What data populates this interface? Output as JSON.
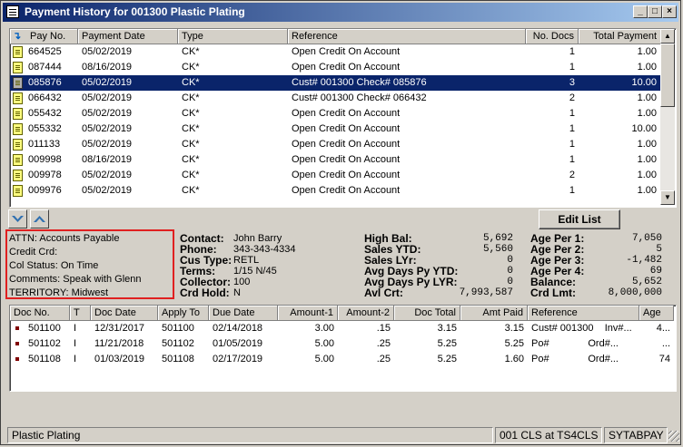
{
  "window": {
    "title": "Payment History for 001300 Plastic Plating"
  },
  "payments": {
    "columns": [
      "Pay No.",
      "Payment Date",
      "Type",
      "Reference",
      "No. Docs",
      "Total Payment"
    ],
    "rows": [
      {
        "pay_no": "664525",
        "date": "05/02/2019",
        "type": "CK*",
        "reference": "Open Credit On Account",
        "docs": "1",
        "total": "1.00"
      },
      {
        "pay_no": "087444",
        "date": "08/16/2019",
        "type": "CK*",
        "reference": "Open Credit On Account",
        "docs": "1",
        "total": "1.00"
      },
      {
        "pay_no": "085876",
        "date": "05/02/2019",
        "type": "CK*",
        "reference": "Cust# 001300  Check# 085876",
        "docs": "3",
        "total": "10.00"
      },
      {
        "pay_no": "066432",
        "date": "05/02/2019",
        "type": "CK*",
        "reference": "Cust# 001300  Check# 066432",
        "docs": "2",
        "total": "1.00"
      },
      {
        "pay_no": "055432",
        "date": "05/02/2019",
        "type": "CK*",
        "reference": "Open Credit On Account",
        "docs": "1",
        "total": "1.00"
      },
      {
        "pay_no": "055332",
        "date": "05/02/2019",
        "type": "CK*",
        "reference": "Open Credit On Account",
        "docs": "1",
        "total": "10.00"
      },
      {
        "pay_no": "011133",
        "date": "05/02/2019",
        "type": "CK*",
        "reference": "Open Credit On Account",
        "docs": "1",
        "total": "1.00"
      },
      {
        "pay_no": "009998",
        "date": "08/16/2019",
        "type": "CK*",
        "reference": "Open Credit On Account",
        "docs": "1",
        "total": "1.00"
      },
      {
        "pay_no": "009978",
        "date": "05/02/2019",
        "type": "CK*",
        "reference": "Open Credit On Account",
        "docs": "2",
        "total": "1.00"
      },
      {
        "pay_no": "009976",
        "date": "05/02/2019",
        "type": "CK*",
        "reference": "Open Credit On Account",
        "docs": "1",
        "total": "1.00"
      }
    ]
  },
  "toolbar": {
    "edit_list": "Edit List"
  },
  "notes": {
    "attn": "ATTN: Accounts Payable",
    "credit": "Credit Crd:",
    "col_status": "Col Status: On Time",
    "comments": "Comments: Speak with Glenn",
    "territory": "TERRITORY: Midwest"
  },
  "customer": {
    "contact_label": "Contact:",
    "contact": "John Barry",
    "phone_label": "Phone:",
    "phone": "343-343-4334",
    "custype_label": "Cus Type:",
    "custype": "RETL",
    "terms_label": "Terms:",
    "terms": "1/15 N/45",
    "collector_label": "Collector:",
    "collector": "100",
    "crdhold_label": "Crd Hold:",
    "crdhold": "N"
  },
  "stats": {
    "high_bal_label": "High Bal:",
    "high_bal": "5,692",
    "sales_ytd_label": "Sales YTD:",
    "sales_ytd": "5,560",
    "sales_lyr_label": "Sales LYr:",
    "sales_lyr": "0",
    "avg_ytd_label": "Avg Days Py YTD:",
    "avg_ytd": "0",
    "avg_lyr_label": "Avg Days Py LYR:",
    "avg_lyr": "0",
    "avl_crt_label": "Avl Crt:",
    "avl_crt": "7,993,587"
  },
  "aging": {
    "age1_label": "Age Per 1:",
    "age1": "7,050",
    "age2_label": "Age Per 2:",
    "age2": "5",
    "age3_label": "Age Per 3:",
    "age3": "-1,482",
    "age4_label": "Age Per 4:",
    "age4": "69",
    "balance_label": "Balance:",
    "balance": "5,652",
    "crd_lmt_label": "Crd Lmt:",
    "crd_lmt": "8,000,000"
  },
  "docs": {
    "columns": [
      "Doc No.",
      "T",
      "Doc Date",
      "Apply To",
      "Due Date",
      "Amount-1",
      "Amount-2",
      "Doc Total",
      "Amt Paid",
      "Reference",
      "Age"
    ],
    "rows": [
      {
        "doc_no": "501100",
        "t": "I",
        "doc_date": "12/31/2017",
        "apply_to": "501100",
        "due_date": "02/14/2018",
        "amt1": "3.00",
        "amt2": ".15",
        "doc_total": "3.15",
        "amt_paid": "3.15",
        "reference": "Cust# 001300    Inv#...",
        "age": "4..."
      },
      {
        "doc_no": "501102",
        "t": "I",
        "doc_date": "11/21/2018",
        "apply_to": "501102",
        "due_date": "01/05/2019",
        "amt1": "5.00",
        "amt2": ".25",
        "doc_total": "5.25",
        "amt_paid": "5.25",
        "reference": "Po#              Ord#...",
        "age": "..."
      },
      {
        "doc_no": "501108",
        "t": "I",
        "doc_date": "01/03/2019",
        "apply_to": "501108",
        "due_date": "02/17/2019",
        "amt1": "5.00",
        "amt2": ".25",
        "doc_total": "5.25",
        "amt_paid": "1.60",
        "reference": "Po#              Ord#...",
        "age": "74"
      }
    ]
  },
  "statusbar": {
    "customer": "Plastic Plating",
    "location": "001 CLS at TS4CLS",
    "program": "SYTABPAY"
  }
}
